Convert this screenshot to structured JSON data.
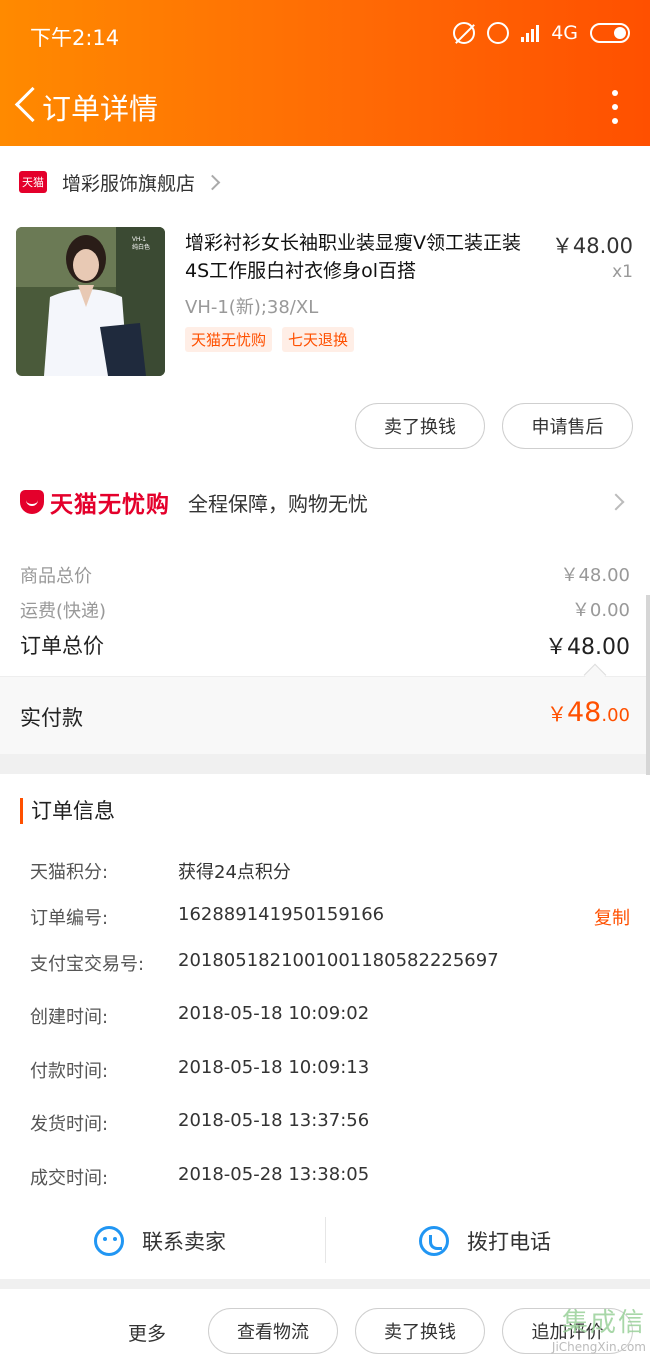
{
  "status_bar": {
    "time": "下午2:14",
    "network": "4G"
  },
  "header": {
    "title": "订单详情"
  },
  "shop": {
    "badge": "天猫",
    "name": "增彩服饰旗舰店"
  },
  "product": {
    "image_text": "VH-1\n纯白色",
    "title": "增彩衬衫女长袖职业装显瘦V领工装正装4S工作服白衬衣修身ol百搭",
    "price": "￥48.00",
    "quantity": "x1",
    "sku": "VH-1(新);38/XL",
    "tags": [
      "天猫无忧购",
      "七天退换"
    ]
  },
  "item_actions": {
    "sell_label": "卖了换钱",
    "after_sale_label": "申请售后"
  },
  "guarantee": {
    "logo": "天猫无忧购",
    "text": "全程保障，购物无忧"
  },
  "summary": {
    "goods_total_label": "商品总价",
    "goods_total_value": "￥48.00",
    "shipping_label": "运费(快递)",
    "shipping_value": "￥0.00",
    "order_total_label": "订单总价",
    "order_total_value": "￥48.00",
    "paid_label": "实付款",
    "paid_symbol": "￥",
    "paid_int": "48",
    "paid_dec": ".00"
  },
  "order_info": {
    "title": "订单信息",
    "copy_label": "复制",
    "rows": [
      {
        "label": "天猫积分:",
        "value": "获得24点积分"
      },
      {
        "label": "订单编号:",
        "value": "162889141950159166"
      },
      {
        "label": "支付宝交易号:",
        "value": "2018051821001001180582225697"
      },
      {
        "label": "创建时间:",
        "value": "2018-05-18 10:09:02"
      },
      {
        "label": "付款时间:",
        "value": "2018-05-18 10:09:13"
      },
      {
        "label": "发货时间:",
        "value": "2018-05-18 13:37:56"
      },
      {
        "label": "成交时间:",
        "value": "2018-05-28 13:38:05"
      }
    ]
  },
  "contact": {
    "seller_label": "联系卖家",
    "phone_label": "拨打电话"
  },
  "bottom_bar": {
    "more_label": "更多",
    "logistics_label": "查看物流",
    "sell_label": "卖了换钱",
    "review_label": "追加评价"
  },
  "watermark": {
    "main": "集成信",
    "sub": "JiChengXin.com"
  },
  "colors": {
    "accent": "#ff5000",
    "tmall_red": "#e4002b",
    "link_blue": "#2196f3"
  }
}
